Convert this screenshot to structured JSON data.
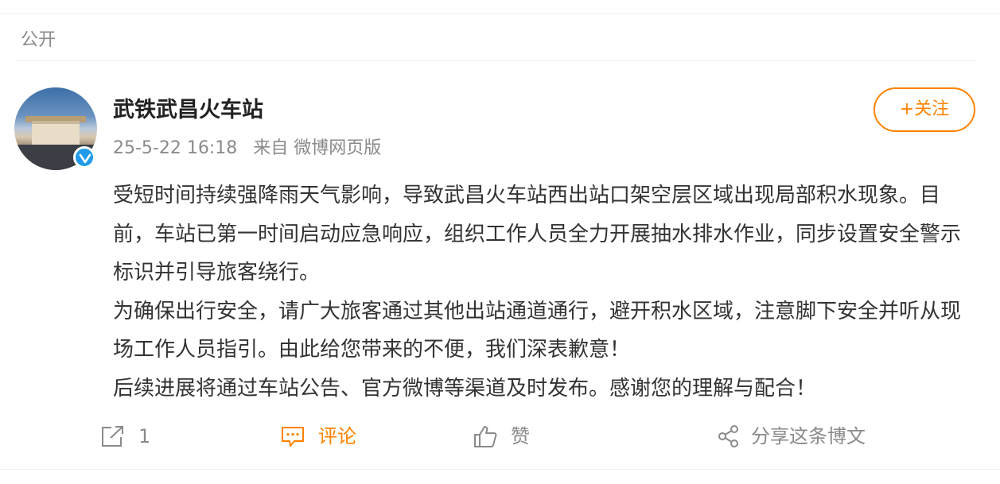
{
  "visibility_label": "公开",
  "post": {
    "author": "武铁武昌火车站",
    "time": "25-5-22 16:18",
    "source": "来自 微博网页版",
    "follow_label": "+关注",
    "paragraphs": [
      "受短时间持续强降雨天气影响，导致武昌火车站西出站口架空层区域出现局部积水现象。目前，车站已第一时间启动应急响应，组织工作人员全力开展抽水排水作业，同步设置安全警示标识并引导旅客绕行。",
      "为确保出行安全，请广大旅客通过其他出站通道通行，避开积水区域，注意脚下安全并听从现场工作人员指引。由此给您带来的不便，我们深表歉意！",
      "后续进展将通过车站公告、官方微博等渠道及时发布。感谢您的理解与配合！"
    ]
  },
  "actions": {
    "repost_count": "1",
    "comment_label": "评论",
    "like_label": "赞",
    "share_label": "分享这条博文"
  },
  "colors": {
    "accent": "#ff8200",
    "muted": "#8a8a8a",
    "verified": "#1f9bea"
  },
  "icons": [
    "repost-icon",
    "comment-icon",
    "like-icon",
    "share-icon",
    "verified-icon"
  ]
}
